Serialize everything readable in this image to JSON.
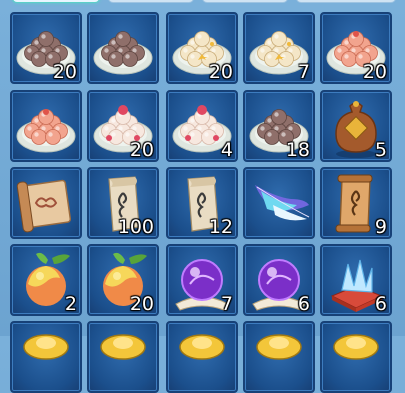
{
  "tabs": [
    "",
    "",
    "",
    ""
  ],
  "items": [
    {
      "name": "sesame-dumpling-plate-icon",
      "count": "20"
    },
    {
      "name": "sesame-dumpling-plate-icon",
      "count": ""
    },
    {
      "name": "osmanthus-dumpling-plate-icon",
      "count": "20"
    },
    {
      "name": "osmanthus-dumpling-plate-icon",
      "count": "7"
    },
    {
      "name": "red-dumpling-plate-icon",
      "count": "20"
    },
    {
      "name": "red-dumpling-plate-icon",
      "count": ""
    },
    {
      "name": "rose-dumpling-plate-icon",
      "count": "20"
    },
    {
      "name": "rose-dumpling-plate-icon",
      "count": "4"
    },
    {
      "name": "sesame-dumpling-plate-icon",
      "count": "18"
    },
    {
      "name": "treasure-pouch-icon",
      "count": "5"
    },
    {
      "name": "cloud-scroll-icon",
      "count": ""
    },
    {
      "name": "paper-talisman-icon",
      "count": "100"
    },
    {
      "name": "paper-talisman-icon",
      "count": "12"
    },
    {
      "name": "feather-wing-icon",
      "count": ""
    },
    {
      "name": "brown-talisman-scroll-icon",
      "count": "9"
    },
    {
      "name": "immortal-peach-icon",
      "count": "2"
    },
    {
      "name": "immortal-peach-icon",
      "count": "20"
    },
    {
      "name": "purple-orb-icon",
      "count": "7"
    },
    {
      "name": "purple-orb-icon",
      "count": "6"
    },
    {
      "name": "ice-crystal-cushion-icon",
      "count": "6"
    },
    {
      "name": "gold-ingot-icon",
      "count": ""
    },
    {
      "name": "gold-ingot-icon",
      "count": ""
    },
    {
      "name": "gold-ingot-icon",
      "count": ""
    },
    {
      "name": "gold-ingot-icon",
      "count": ""
    },
    {
      "name": "gold-ingot-icon",
      "count": ""
    }
  ]
}
